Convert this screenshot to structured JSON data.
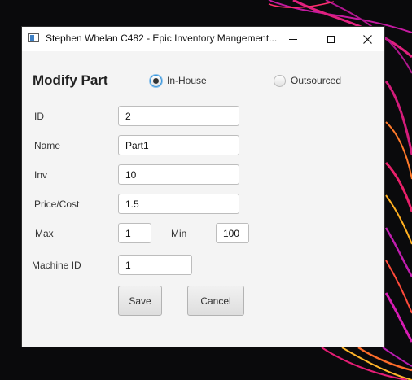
{
  "window": {
    "title": "Stephen Whelan C482 - Epic Inventory Mangement...",
    "controls": {
      "minimize_icon": "minimize-icon",
      "maximize_icon": "maximize-icon",
      "close_icon": "close-icon"
    }
  },
  "form": {
    "heading": "Modify Part",
    "source_options": [
      {
        "label": "In-House",
        "selected": true
      },
      {
        "label": "Outsourced",
        "selected": false
      }
    ],
    "fields": {
      "id": {
        "label": "ID",
        "value": "2"
      },
      "name": {
        "label": "Name",
        "value": "Part1"
      },
      "inv": {
        "label": "Inv",
        "value": "10"
      },
      "price": {
        "label": "Price/Cost",
        "value": "1.5"
      },
      "max": {
        "label": "Max",
        "value": "1"
      },
      "min": {
        "label": "Min",
        "value": "100"
      },
      "machine_id": {
        "label": "Machine ID",
        "value": "1"
      }
    },
    "buttons": {
      "save": "Save",
      "cancel": "Cancel"
    }
  },
  "colors": {
    "focus_accent": "#2d8fd9",
    "window_background": "#f4f4f4",
    "desktop_background": "#0a0a0c"
  }
}
